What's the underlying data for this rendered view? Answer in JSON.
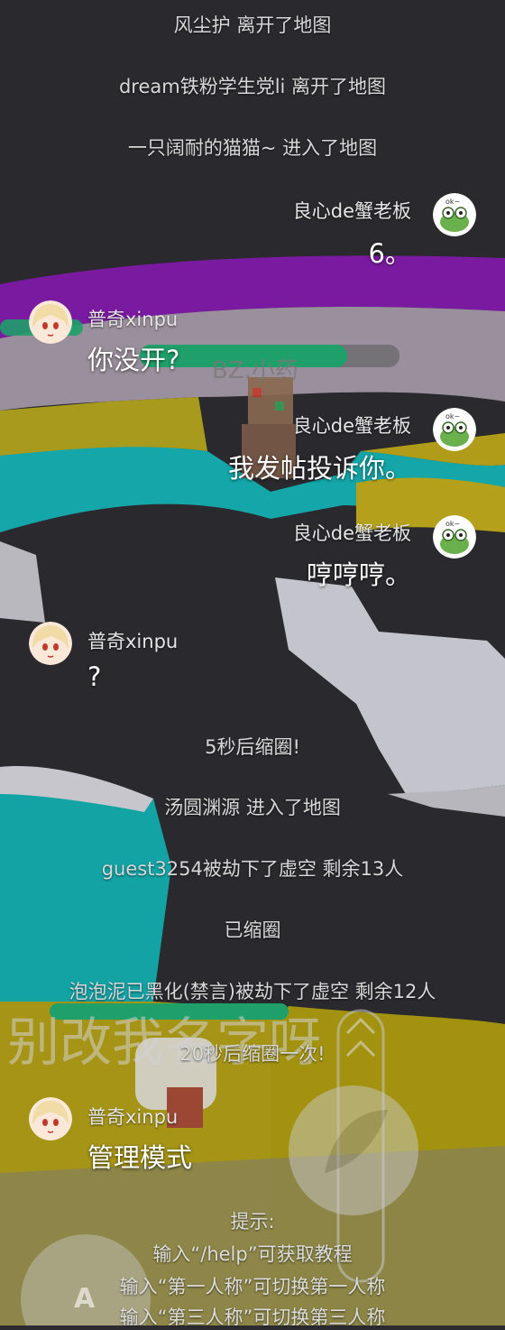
{
  "scene": {
    "overlay_text": "别改我名字呀",
    "bubble_text": "BZ.小药",
    "joystick_label": "A",
    "colors": {
      "background": "#2c2c30",
      "purple_band": "#7a1aa0",
      "teal_band": "#14a6a8",
      "yellow_band": "#b6a21a",
      "health_green": "#1fa06a"
    }
  },
  "chat": {
    "system_top": [
      "风尘护 离开了地图",
      "dream铁粉学生党li 离开了地图",
      "一只阔耐的猫猫~ 进入了地图"
    ],
    "messages": [
      {
        "sender": "良心de蟹老板",
        "text": "6。",
        "avatar": "crocodile-avatar"
      },
      {
        "sender": "普奇xinpu",
        "text": "你没开?",
        "avatar": "anime-girl-avatar"
      },
      {
        "sender": "良心de蟹老板",
        "text": "我发帖投诉你。",
        "avatar": "crocodile-avatar"
      },
      {
        "sender": "良心de蟹老板",
        "text": "哼哼哼。",
        "avatar": "crocodile-avatar"
      },
      {
        "sender": "普奇xinpu",
        "text": "?",
        "avatar": "anime-girl-avatar"
      }
    ],
    "system_mid": [
      "5秒后缩圈!",
      "汤圆渊源 进入了地图",
      "guest3254被劫下了虚空 剩余13人",
      "已缩圈",
      "泡泡泥已黑化(禁言)被劫下了虚空 剩余12人",
      "20秒后缩圈一次!"
    ],
    "last_message": {
      "sender": "普奇xinpu",
      "text": "管理模式",
      "avatar": "anime-girl-avatar"
    },
    "tips": {
      "title": "提示:",
      "lines": [
        "输入“/help”可获取教程",
        "输入“第一人称”可切换第一人称",
        "输入“第三人称”可切换第三人称"
      ]
    }
  }
}
